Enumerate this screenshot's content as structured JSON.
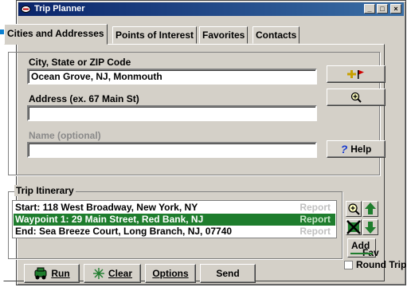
{
  "window": {
    "title": "Trip Planner"
  },
  "title_buttons": {
    "minimize": "_",
    "maximize": "□",
    "close": "×"
  },
  "tabs": [
    {
      "label": "Cities and Addresses"
    },
    {
      "label": "Points of Interest"
    },
    {
      "label": "Favorites"
    },
    {
      "label": "Contacts"
    }
  ],
  "address": {
    "city_label": "City, State or ZIP Code",
    "city_value": "Ocean Grove, NJ, Monmouth",
    "address_label": "Address (ex. 67 Main St)",
    "address_value": "",
    "name_label": "Name (optional)",
    "name_value": "",
    "help_label": "Help"
  },
  "itinerary": {
    "label": "Trip Itinerary",
    "items": [
      {
        "text": "Start: 118 West Broadway, New York, NY",
        "report": "Report",
        "selected": false
      },
      {
        "text": "Waypoint 1: 29 Main Street, Red Bank, NJ",
        "report": "Report",
        "selected": true
      },
      {
        "text": "End: Sea Breeze Court, Long Branch, NJ, 07740",
        "report": "Report",
        "selected": false
      }
    ],
    "add_fav": {
      "line1": "Add",
      "line2": "Fav"
    },
    "round_trip_label": "Round Trip"
  },
  "bottom_buttons": {
    "run": "Run",
    "clear": "Clear",
    "options": "Options",
    "send": "Send"
  },
  "icons": [
    "pointer-arrow-icon",
    "app-icon",
    "add-waypoint-icon",
    "zoom-in-icon",
    "help-icon",
    "move-up-icon",
    "move-down-icon",
    "delete-icon",
    "run-icon",
    "clear-icon"
  ],
  "colors": {
    "accent": "#1e7d2d",
    "title_bar": "#0a246a",
    "pointer": "#0a7fd0"
  }
}
